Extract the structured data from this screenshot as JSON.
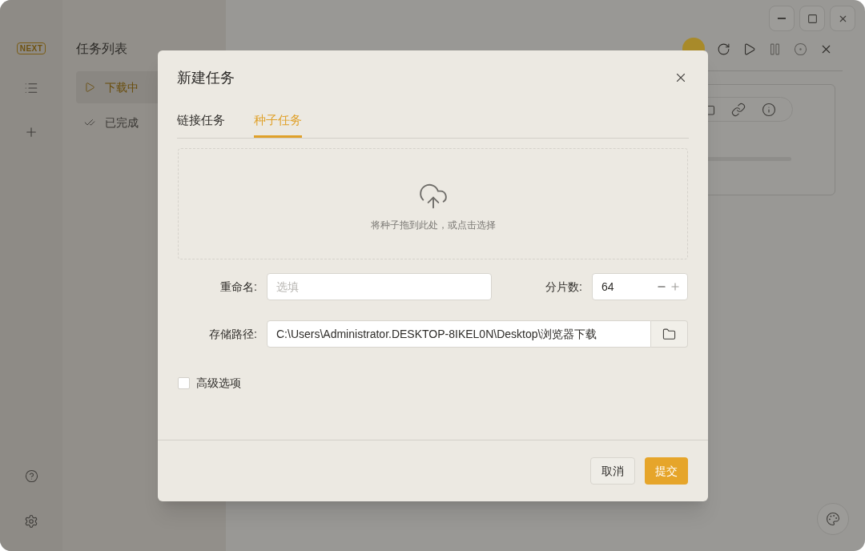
{
  "app": {
    "logo": "NEXT"
  },
  "task_list": {
    "title": "任务列表",
    "items": [
      {
        "label": "下载中",
        "kind": "downloading",
        "selected": true
      },
      {
        "label": "已完成",
        "kind": "done",
        "selected": false
      }
    ]
  },
  "dialog": {
    "title": "新建任务",
    "tabs": [
      {
        "label": "链接任务",
        "selected": false
      },
      {
        "label": "种子任务",
        "selected": true
      }
    ],
    "dropzone": {
      "hint": "将种子拖到此处，或点击选择"
    },
    "rename": {
      "label": "重命名:",
      "placeholder": "选填"
    },
    "chunks": {
      "label": "分片数:",
      "value": "64"
    },
    "path": {
      "label": "存储路径:",
      "value": "C:\\Users\\Administrator.DESKTOP-8IKEL0N\\Desktop\\浏览器下载"
    },
    "advanced": {
      "label": "高级选项",
      "checked": false
    },
    "buttons": [
      {
        "label": "取消",
        "kind": "secondary"
      },
      {
        "label": "提交",
        "kind": "primary"
      }
    ]
  }
}
